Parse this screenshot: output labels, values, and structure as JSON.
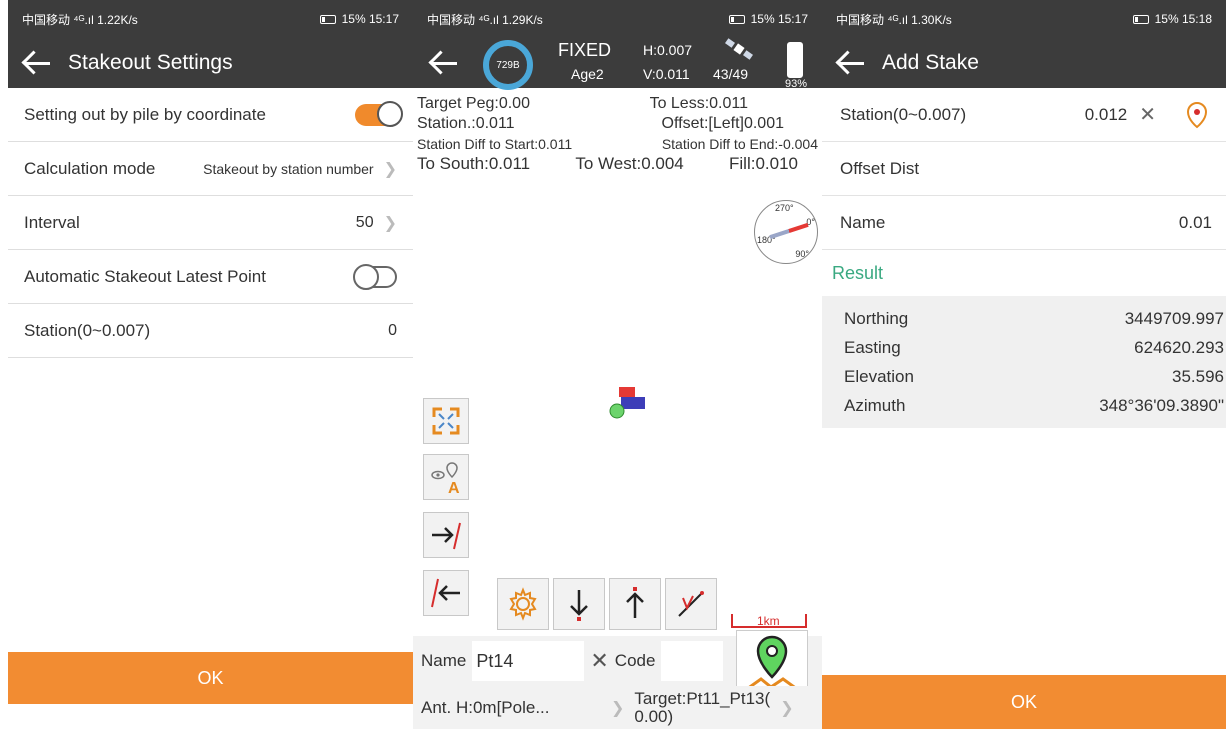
{
  "statusbars": [
    {
      "left": "中国移动 ⁴ᴳ.ıl 1.22K/s",
      "right": "15% 15:17"
    },
    {
      "left": "中国移动 ⁴ᴳ.ıl 1.29K/s",
      "right": "15% 15:17"
    },
    {
      "left": "中国移动 ⁴ᴳ.ıl 1.30K/s",
      "right": "15% 15:18"
    }
  ],
  "stakeout_settings": {
    "title": "Stakeout Settings",
    "rows": [
      {
        "label": "Setting out by pile by coordinate",
        "toggle": "on"
      },
      {
        "label": "Calculation mode",
        "value": "Stakeout by station number"
      },
      {
        "label": "Interval",
        "value": "50"
      },
      {
        "label": "Automatic Stakeout Latest Point",
        "toggle": "off"
      },
      {
        "label": "Station(0~0.007)",
        "value": "0"
      }
    ],
    "ok": "OK"
  },
  "stakeout_map": {
    "ring_label": "729B",
    "fix_status": "FIXED",
    "age": "Age2",
    "h": "H:0.007",
    "v": "V:0.011",
    "sats": "43/49",
    "battery": "93%",
    "info": {
      "target_peg": "Target Peg:0.00",
      "to_less": "To Less:0.011",
      "station": "Station.:0.011",
      "offset": "Offset:[Left]0.001",
      "diff_start": "Station Diff to Start:0.011",
      "diff_end": "Station Diff to End:-0.004",
      "to_south": "To South:0.011",
      "to_west": "To West:0.004",
      "fill": "Fill:0.010"
    },
    "compass": {
      "n270": "270°",
      "n0": "0°",
      "n180": "180°",
      "n90": "90°"
    },
    "scale": "1km",
    "name_label": "Name",
    "name_value": "Pt14",
    "code_label": "Code",
    "antenna": "Ant. H:0m[Pole...",
    "target": "Target:Pt11_Pt13(",
    "target2": "0.00)"
  },
  "add_stake": {
    "title": "Add Stake",
    "station_label": "Station(0~0.007)",
    "station_value": "0.012",
    "offset_label": "Offset Dist",
    "name_label": "Name",
    "name_value": "0.01",
    "result_title": "Result",
    "results": [
      {
        "label": "Northing",
        "value": "3449709.997"
      },
      {
        "label": "Easting",
        "value": "624620.293"
      },
      {
        "label": "Elevation",
        "value": "35.596"
      },
      {
        "label": "Azimuth",
        "value": "348°36'09.3890\""
      }
    ],
    "ok": "OK"
  },
  "colors": {
    "accent": "#f28c32",
    "result_green": "#3aa981",
    "bar_dark": "#3c3c3c",
    "ring_blue": "#4aa7d8"
  }
}
